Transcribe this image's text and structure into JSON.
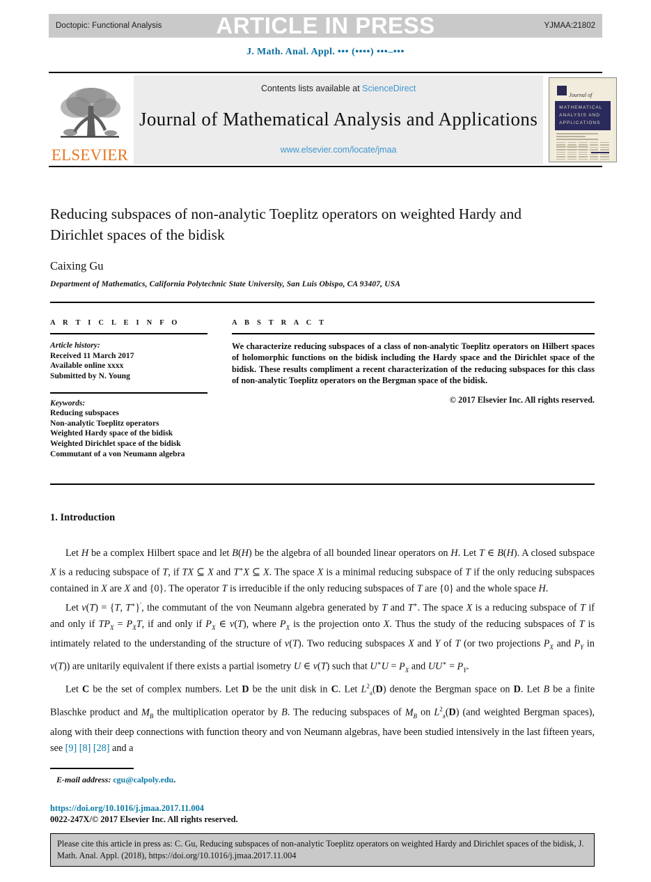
{
  "header": {
    "doctopic": "Doctopic: Functional Analysis",
    "banner": "ARTICLE IN PRESS",
    "article_id": "YJMAA:21802",
    "running_head_prefix": "J. Math. Anal. Appl.",
    "running_head_dots": "••• (••••) •••–•••"
  },
  "masthead": {
    "publisher": "ELSEVIER",
    "contents_prefix": "Contents lists available at",
    "contents_link": "ScienceDirect",
    "journal_title": "Journal of Mathematical Analysis and Applications",
    "journal_url": "www.elsevier.com/locate/jmaa",
    "cover": {
      "script": "Journal of",
      "band": "MATHEMATICAL ANALYSIS AND APPLICATIONS"
    }
  },
  "article": {
    "title": "Reducing subspaces of non-analytic Toeplitz operators on weighted Hardy and Dirichlet spaces of the bidisk",
    "author": "Caixing Gu",
    "affiliation": "Department of Mathematics, California Polytechnic State University, San Luis Obispo, CA 93407, USA"
  },
  "info": {
    "label": "A R T I C L E    I N F O",
    "history_label": "Article history:",
    "history": [
      "Received 11 March 2017",
      "Available online xxxx",
      "Submitted by N. Young"
    ],
    "keywords_label": "Keywords:",
    "keywords": [
      "Reducing subspaces",
      "Non-analytic Toeplitz operators",
      "Weighted Hardy space of the bidisk",
      "Weighted Dirichlet space of the bidisk",
      "Commutant of a von Neumann algebra"
    ]
  },
  "abstract": {
    "label": "A B S T R A C T",
    "text": "We characterize reducing subspaces of a class of non-analytic Toeplitz operators on Hilbert spaces of holomorphic functions on the bidisk including the Hardy space and the Dirichlet space of the bidisk. These results compliment a recent characterization of the reducing subspaces for this class of non-analytic Toeplitz operators on the Bergman space of the bidisk.",
    "copyright": "© 2017 Elsevier Inc. All rights reserved."
  },
  "body": {
    "section_heading": "1. Introduction",
    "paragraph_1": "Let H be a complex Hilbert space and let B(H) be the algebra of all bounded linear operators on H. Let T ∈ B(H). A closed subspace X is a reducing subspace of T, if TX ⊆ X and T*X ⊆ X. The space X is a minimal reducing subspace of T if the only reducing subspaces contained in X are X and {0}. The operator T is irreducible if the only reducing subspaces of T are {0} and the whole space H.",
    "paragraph_2": "Let ν(T) = {T, T*}′, the commutant of the von Neumann algebra generated by T and T*. The space X is a reducing subspace of T if and only if TP_X = P_X T, if and only if P_X ∈ ν(T), where P_X is the projection onto X. Thus the study of the reducing subspaces of T is intimately related to the understanding of the structure of ν(T). Two reducing subspaces X and Y of T (or two projections P_X and P_Y in ν(T)) are unitarily equivalent if there exists a partial isometry U ∈ ν(T) such that U*U = P_X and UU* = P_Y.",
    "paragraph_3": "Let C be the set of complex numbers. Let D be the unit disk in C. Let L²ₐ(D) denote the Bergman space on D. Let B be a finite Blaschke product and M_B the multiplication operator by B. The reducing subspaces of M_B on L²ₐ(D) (and weighted Bergman spaces), along with their deep connections with function theory and von Neumann algebras, have been studied intensively in the last fifteen years, see [9] [8] [28] and a",
    "references_inline": [
      "[9]",
      "[8]",
      "[28]"
    ]
  },
  "footnote": {
    "email_label": "E-mail address:",
    "email": "cgu@calpoly.edu",
    "email_trailing": ".",
    "doi": "https://doi.org/10.1016/j.jmaa.2017.11.004",
    "issn_line": "0022-247X/© 2017 Elsevier Inc. All rights reserved."
  },
  "cite_box": {
    "text": "Please cite this article in press as: C. Gu, Reducing subspaces of non-analytic Toeplitz operators on weighted Hardy and Dirichlet spaces of the bidisk, J. Math. Anal. Appl. (2018), https://doi.org/10.1016/j.jmaa.2017.11.004"
  },
  "colors": {
    "link": "#0b7ba6",
    "sciencedirect": "#3f96cf",
    "elsevier_orange": "#e87722",
    "banner_bg": "#c9c9c9",
    "masthead_bg": "#ececec",
    "cover_band": "#2b2a5c"
  }
}
